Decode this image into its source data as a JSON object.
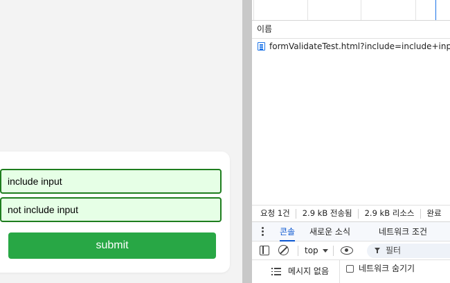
{
  "page": {
    "form": {
      "field1_value": "include input",
      "field2_value": "not include input",
      "submit_label": "submit"
    }
  },
  "devtools": {
    "network": {
      "name_column_header": "이름",
      "requests": [
        {
          "name": "formValidateTest.html?include=include+input",
          "icon": "document-icon"
        }
      ],
      "summary": {
        "requests": "요청 1건",
        "transferred": "2.9 kB 전송됨",
        "resources": "2.9 kB 리소스",
        "finish": "완료"
      }
    },
    "drawer": {
      "tabs": [
        {
          "label": "콘솔",
          "active": true
        },
        {
          "label": "새로운 소식",
          "active": false
        },
        {
          "label": "네트워크 조건",
          "active": false
        }
      ]
    },
    "console": {
      "context": "top",
      "filter_placeholder": "필터",
      "sidebar_no_messages": "메시지 없음",
      "hide_network_label": "네트워크 숨기기",
      "hide_network_checked": false
    }
  },
  "colors": {
    "field_bg": "#e6ffe6",
    "field_border": "#1e7d1e",
    "submit_bg": "#28a745",
    "active_tab": "#0b57d0",
    "doc_icon": "#1a73e8"
  }
}
